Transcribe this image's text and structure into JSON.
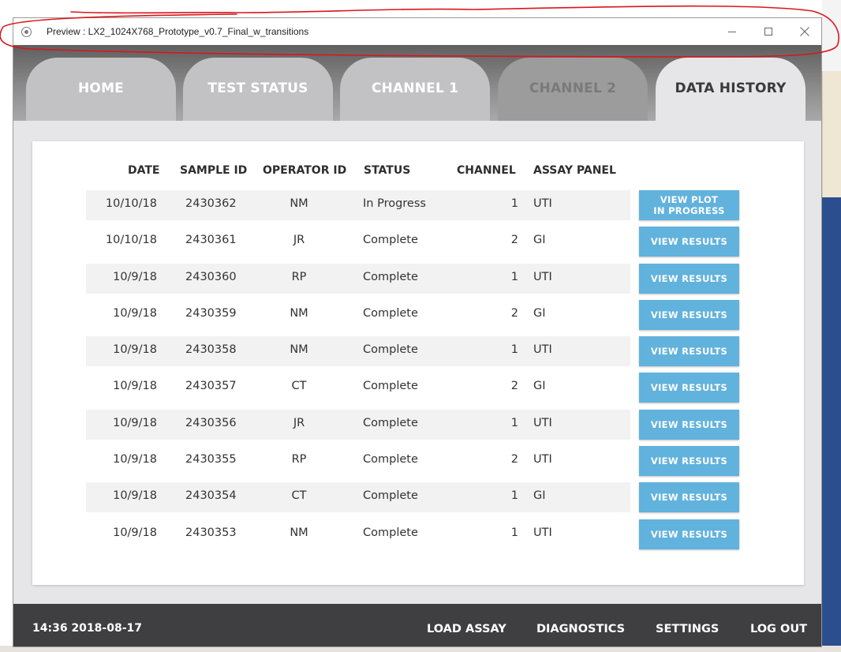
{
  "window": {
    "title": "Preview : LX2_1024X768_Prototype_v0.7_Final_w_transitions",
    "controls": [
      "minimize",
      "maximize",
      "close"
    ]
  },
  "tabs": [
    {
      "label": "HOME",
      "state": "normal"
    },
    {
      "label": "TEST STATUS",
      "state": "normal"
    },
    {
      "label": "CHANNEL 1",
      "state": "normal"
    },
    {
      "label": "CHANNEL 2",
      "state": "disabled"
    },
    {
      "label": "DATA HISTORY",
      "state": "active"
    }
  ],
  "table": {
    "headers": {
      "date": "DATE",
      "sample_id": "SAMPLE ID",
      "operator_id": "OPERATOR ID",
      "status": "STATUS",
      "channel": "CHANNEL",
      "assay_panel": "ASSAY PANEL"
    },
    "rows": [
      {
        "date": "10/10/18",
        "sample_id": "2430362",
        "operator_id": "NM",
        "status": "In Progress",
        "channel": "1",
        "assay_panel": "UTI",
        "action": "VIEW PLOT\nIN PROGRESS"
      },
      {
        "date": "10/10/18",
        "sample_id": "2430361",
        "operator_id": "JR",
        "status": "Complete",
        "channel": "2",
        "assay_panel": "GI",
        "action": "VIEW RESULTS"
      },
      {
        "date": "10/9/18",
        "sample_id": "2430360",
        "operator_id": "RP",
        "status": "Complete",
        "channel": "1",
        "assay_panel": "UTI",
        "action": "VIEW RESULTS"
      },
      {
        "date": "10/9/18",
        "sample_id": "2430359",
        "operator_id": "NM",
        "status": "Complete",
        "channel": "2",
        "assay_panel": "GI",
        "action": "VIEW RESULTS"
      },
      {
        "date": "10/9/18",
        "sample_id": "2430358",
        "operator_id": "NM",
        "status": "Complete",
        "channel": "1",
        "assay_panel": "UTI",
        "action": "VIEW RESULTS"
      },
      {
        "date": "10/9/18",
        "sample_id": "2430357",
        "operator_id": "CT",
        "status": "Complete",
        "channel": "2",
        "assay_panel": "GI",
        "action": "VIEW RESULTS"
      },
      {
        "date": "10/9/18",
        "sample_id": "2430356",
        "operator_id": "JR",
        "status": "Complete",
        "channel": "1",
        "assay_panel": "UTI",
        "action": "VIEW RESULTS"
      },
      {
        "date": "10/9/18",
        "sample_id": "2430355",
        "operator_id": "RP",
        "status": "Complete",
        "channel": "2",
        "assay_panel": "UTI",
        "action": "VIEW RESULTS"
      },
      {
        "date": "10/9/18",
        "sample_id": "2430354",
        "operator_id": "CT",
        "status": "Complete",
        "channel": "1",
        "assay_panel": "GI",
        "action": "VIEW RESULTS"
      },
      {
        "date": "10/9/18",
        "sample_id": "2430353",
        "operator_id": "NM",
        "status": "Complete",
        "channel": "1",
        "assay_panel": "UTI",
        "action": "VIEW RESULTS"
      }
    ]
  },
  "footer": {
    "clock": "14:36 2018-08-17",
    "load_assay": "LOAD ASSAY",
    "diagnostics": "DIAGNOSTICS",
    "settings": "SETTINGS",
    "log_out": "LOG OUT"
  },
  "colors": {
    "button_blue": "#61b2dd",
    "footer_dark": "#3f3f41",
    "annotation_red": "#d9171b",
    "tab_inactive": "#c2c2c4",
    "tab_active": "#e6e6e8"
  },
  "icons": {
    "app": "radio-app-icon",
    "minimize": "minimize-icon",
    "maximize": "maximize-icon",
    "close": "close-icon"
  }
}
